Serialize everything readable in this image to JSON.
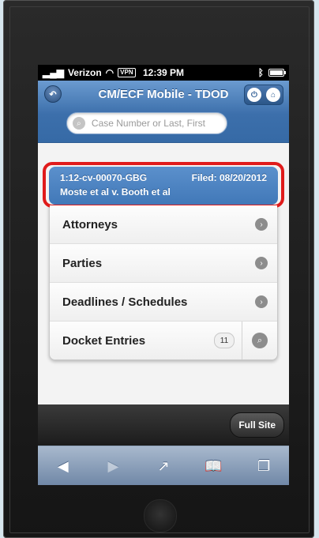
{
  "status_bar": {
    "carrier": "Verizon",
    "vpn": "VPN",
    "time": "12:39 PM"
  },
  "header": {
    "title": "CM/ECF Mobile - TDOD",
    "search_placeholder": "Case Number or Last, First"
  },
  "case": {
    "number": "1:12-cv-00070-GBG",
    "filed": "Filed: 08/20/2012",
    "name": "Moste et al v. Booth et al"
  },
  "menu": {
    "items": [
      {
        "label": "Attorneys"
      },
      {
        "label": "Parties"
      },
      {
        "label": "Deadlines / Schedules"
      },
      {
        "label": "Docket Entries",
        "count": "11"
      }
    ]
  },
  "footer": {
    "full_site": "Full Site"
  },
  "colors": {
    "header_blue": "#3c6fab",
    "case_blue": "#4a80c0",
    "highlight_red": "#e01b1b"
  },
  "icons": {
    "back": "back-icon",
    "power": "power-icon",
    "home": "home-icon",
    "search": "search-icon",
    "arrow": "chevron-right-icon",
    "browser": [
      "back-arrow-icon",
      "forward-arrow-icon",
      "share-icon",
      "bookmarks-icon",
      "tabs-icon"
    ]
  }
}
